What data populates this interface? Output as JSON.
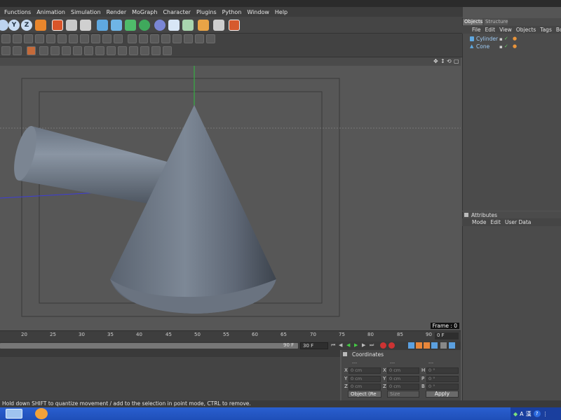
{
  "menu": [
    "Functions",
    "Animation",
    "Simulation",
    "Render",
    "MoGraph",
    "Character",
    "Plugins",
    "Python",
    "Window",
    "Help"
  ],
  "axis_buttons": [
    "X",
    "Y",
    "Z"
  ],
  "viewport": {
    "frame_label": "Frame : 0"
  },
  "timeline": {
    "ticks": [
      "20",
      "25",
      "30",
      "35",
      "40",
      "45",
      "50",
      "55",
      "60",
      "65",
      "70",
      "75",
      "80",
      "85",
      "90"
    ],
    "end_frame_label": "90 F",
    "current_frame": "30 F",
    "right_frame": "0 F"
  },
  "object_manager": {
    "tabs": [
      "Objects",
      "Structure"
    ],
    "menu": [
      "File",
      "Edit",
      "View",
      "Objects",
      "Tags",
      "Bo"
    ],
    "objects": [
      {
        "name": "Cylinder",
        "icon": "cylinder-icon"
      },
      {
        "name": "Cone",
        "icon": "cone-icon"
      }
    ]
  },
  "attributes": {
    "title": "Attributes",
    "menu": [
      "Mode",
      "Edit",
      "User Data"
    ]
  },
  "coordinates": {
    "title": "Coordinates",
    "col_headers": [
      "---",
      "---",
      "---"
    ],
    "rows": [
      {
        "l1": "X",
        "v1": "0 cm",
        "l2": "X",
        "v2": "0 cm",
        "l3": "H",
        "v3": "0 °"
      },
      {
        "l1": "Y",
        "v1": "0 cm",
        "l2": "Y",
        "v2": "0 cm",
        "l3": "P",
        "v3": "0 °"
      },
      {
        "l1": "Z",
        "v1": "0 cm",
        "l2": "Z",
        "v2": "0 cm",
        "l3": "B",
        "v3": "0 °"
      }
    ],
    "mode_dropdown": "Object (Re",
    "size_dropdown": "Size",
    "apply_label": "Apply"
  },
  "status": "Hold down SHIFT to quantize movement / add to the selection in point mode, CTRL to remove.",
  "tray": {
    "lang": "A",
    "ime": "漢"
  }
}
